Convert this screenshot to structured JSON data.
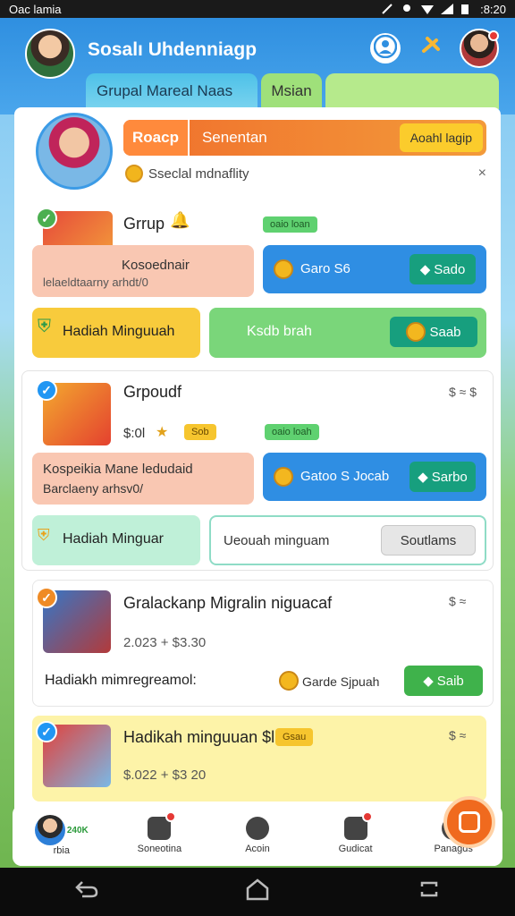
{
  "status_bar": {
    "left": "Oac lamia",
    "time": ":8:20"
  },
  "header": {
    "title": "Sosalı Uhdenniagp"
  },
  "tabs": [
    {
      "label": "Grupal Mareal Naas"
    },
    {
      "label": "Msian"
    },
    {
      "label": ""
    }
  ],
  "banner": {
    "chip": "Roacp",
    "label": "Senentan",
    "button": "Aoahl lagip"
  },
  "subtitle": {
    "text": "Sseclal mdnaflity",
    "close": "×"
  },
  "section1": {
    "name": "Grrup",
    "pill": "oaio loan",
    "box_text_1": "Kosoednair",
    "box_text_2": "lelaeldtaarny arhdt/0",
    "blue_text": "Garo S6",
    "blue_btn": "Sado",
    "yellow_btn": "Hadiah Minguuah",
    "green_text": "Ksdb brah",
    "green_btn": "Saab"
  },
  "section2": {
    "name": "Grpoudf",
    "price": "$:0l",
    "tag": "Sob",
    "pill": "oaio loah",
    "right_small": "$ ≈ $",
    "box_text_1": "Kospeikia Mane ledudaid",
    "box_text_2": "Barclaeny arhsv0/",
    "blue_text": "Gatoo S Jocab",
    "blue_btn": "Sarbo",
    "mint_btn": "Hadiah Minguar",
    "input_text": "Ueouah minguam",
    "gray_btn": "Soutlams"
  },
  "section3": {
    "name": "Gralackanp Migralin niguacaf",
    "price": "2.023 + $3.30",
    "right_small": "$ ≈",
    "bottom_text": "Hadiakh mimregreamol:",
    "bottom_mid": "Garde Sjpuah",
    "green_btn": "Saib"
  },
  "section4": {
    "name": "Hadikah minguuan $l",
    "tag": "Gsau",
    "price": "$.022 + $3 20",
    "right_small": "$ ≈"
  },
  "bottom_nav": [
    {
      "label": "rbia",
      "extra": "240K"
    },
    {
      "label": "Soneotina"
    },
    {
      "label": "Acoin"
    },
    {
      "label": "Gudicat"
    },
    {
      "label": "Panagds"
    }
  ],
  "colors": {
    "accent_blue": "#2f8fe0",
    "accent_orange": "#f06f2c",
    "green": "#4caf50"
  }
}
